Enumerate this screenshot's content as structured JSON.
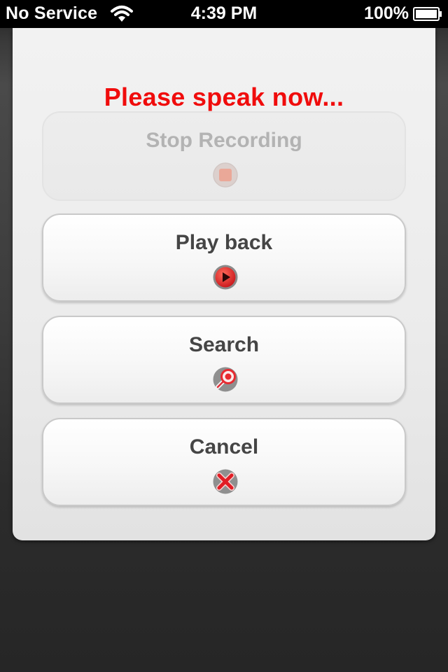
{
  "status_bar": {
    "carrier": "No Service",
    "time": "4:39 PM",
    "battery_percent": "100%",
    "icons": [
      "wifi-icon",
      "battery-icon"
    ]
  },
  "dialog": {
    "title": "Please speak now...",
    "title_color": "#f00c0c",
    "buttons": [
      {
        "label": "Stop Recording",
        "icon": "stop-record-icon",
        "enabled": false
      },
      {
        "label": "Play back",
        "icon": "play-icon",
        "enabled": true
      },
      {
        "label": "Search",
        "icon": "search-icon",
        "enabled": true
      },
      {
        "label": "Cancel",
        "icon": "cancel-icon",
        "enabled": true
      }
    ]
  },
  "colors": {
    "accent_red": "#e8282a",
    "button_text": "#454545",
    "disabled_text": "#b3b3b3"
  }
}
